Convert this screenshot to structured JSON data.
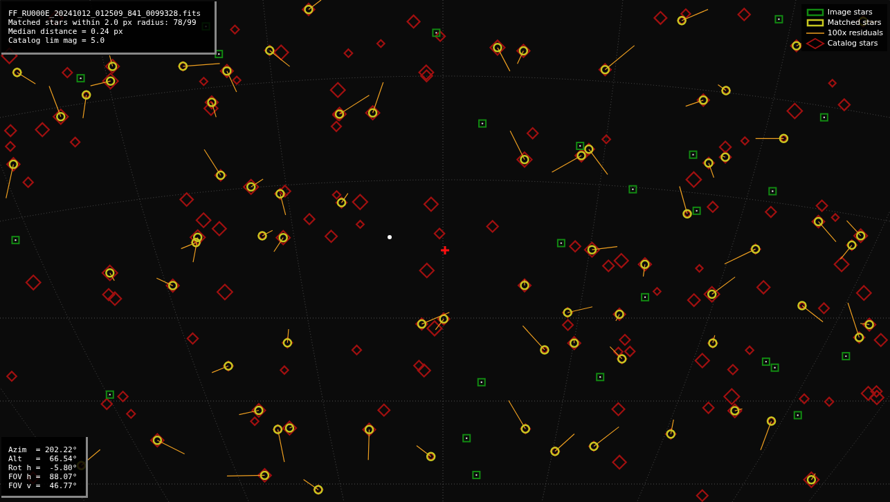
{
  "info_box": {
    "lines": [
      "FF_RU000E_20241012_012509_841_0099328.fits",
      "Matched stars within 2.0 px radius: 78/99",
      "Median distance = 0.24 px",
      "Catalog lim mag = 5.0"
    ]
  },
  "legend": {
    "items": [
      {
        "kind": "image",
        "label": "Image stars"
      },
      {
        "kind": "matched",
        "label": "Matched stars"
      },
      {
        "kind": "residual",
        "label": "100x residuals"
      },
      {
        "kind": "catalog",
        "label": "Catalog stars"
      }
    ]
  },
  "pointing_box": {
    "lines": [
      "Azim  = 202.22°",
      "Alt   =  66.54°",
      "Rot h =  -5.80°",
      "FOV h =  88.07°",
      "FOV v =  46.77°"
    ]
  }
}
